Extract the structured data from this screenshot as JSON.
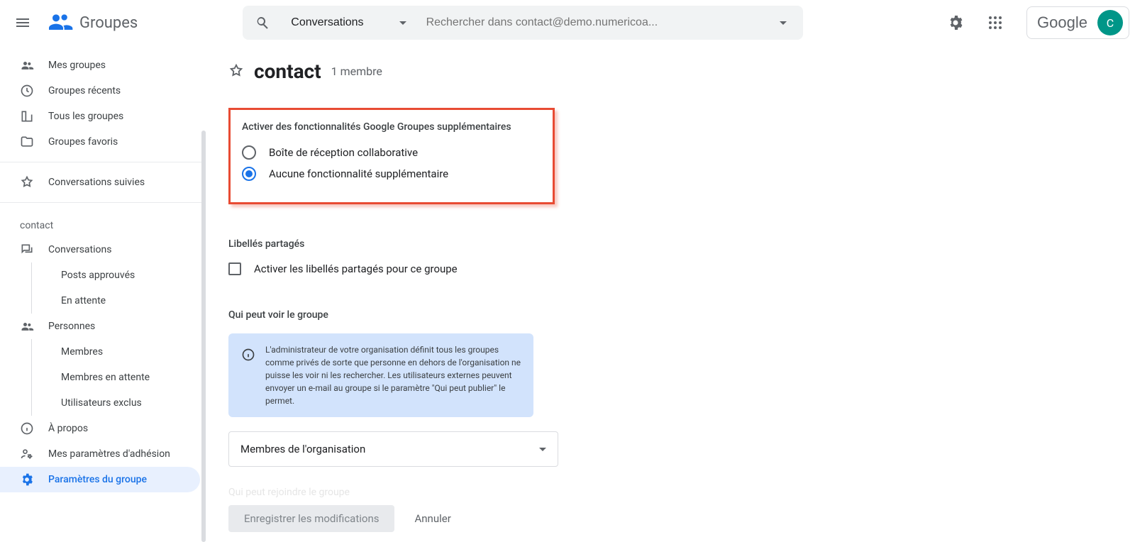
{
  "header": {
    "product_name": "Groupes",
    "search_scope": "Conversations",
    "search_placeholder": "Rechercher dans contact@demo.numericoa...",
    "avatar_initial": "C",
    "google_label": "Google"
  },
  "sidebar": {
    "top": [
      {
        "label": "Mes groupes"
      },
      {
        "label": "Groupes récents"
      },
      {
        "label": "Tous les groupes"
      },
      {
        "label": "Groupes favoris"
      }
    ],
    "mid": [
      {
        "label": "Conversations suivies"
      }
    ],
    "group_heading": "contact",
    "group_items": {
      "conversations": "Conversations",
      "conversations_sub": [
        "Posts approuvés",
        "En attente"
      ],
      "people": "Personnes",
      "people_sub": [
        "Membres",
        "Membres en attente",
        "Utilisateurs exclus"
      ],
      "about": "À propos",
      "membership": "Mes paramètres d'adhésion",
      "settings": "Paramètres du groupe"
    }
  },
  "page": {
    "title": "contact",
    "member_count": "1 membre",
    "highlight": {
      "heading": "Activer des fonctionnalités Google Groupes supplémentaires",
      "option1": "Boîte de réception collaborative",
      "option2": "Aucune fonctionnalité supplémentaire"
    },
    "labels_section": {
      "heading": "Libellés partagés",
      "checkbox": "Activer les libellés partagés pour ce groupe"
    },
    "visibility_section": {
      "heading": "Qui peut voir le groupe",
      "info": "L'administrateur de votre organisation définit tous les groupes comme privés de sorte que personne en dehors de l'organisation ne puisse les voir ni les rechercher. Les utilisateurs externes peuvent envoyer un e-mail au groupe si le paramètre \"Qui peut publier\" le permet.",
      "select_value": "Membres de l'organisation"
    },
    "cutoff_heading": "Qui peut rejoindre le groupe",
    "buttons": {
      "save": "Enregistrer les modifications",
      "cancel": "Annuler"
    }
  }
}
